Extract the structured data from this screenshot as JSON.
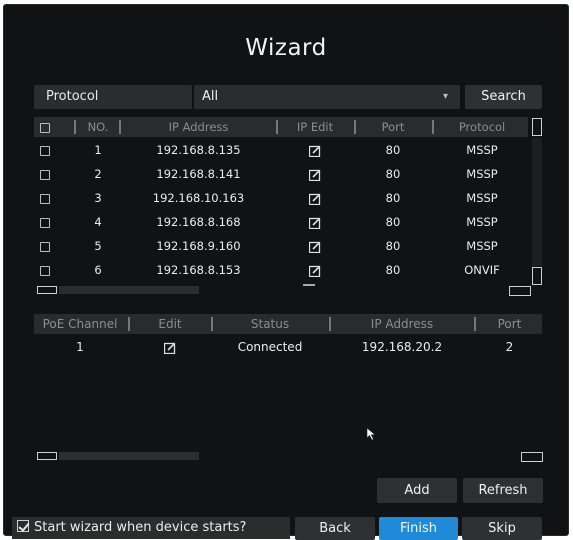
{
  "window": {
    "title": "Wizard"
  },
  "filter": {
    "label": "Protocol",
    "selected": "All",
    "search_label": "Search"
  },
  "device_table": {
    "headers": {
      "no": "NO.",
      "ip": "IP Address",
      "ip_edit": "IP Edit",
      "port": "Port",
      "protocol": "Protocol"
    },
    "rows": [
      {
        "no": "1",
        "ip": "192.168.8.135",
        "port": "80",
        "protocol": "MSSP"
      },
      {
        "no": "2",
        "ip": "192.168.8.141",
        "port": "80",
        "protocol": "MSSP"
      },
      {
        "no": "3",
        "ip": "192.168.10.163",
        "port": "80",
        "protocol": "MSSP"
      },
      {
        "no": "4",
        "ip": "192.168.8.168",
        "port": "80",
        "protocol": "MSSP"
      },
      {
        "no": "5",
        "ip": "192.168.9.160",
        "port": "80",
        "protocol": "MSSP"
      },
      {
        "no": "6",
        "ip": "192.168.8.153",
        "port": "80",
        "protocol": "ONVIF"
      }
    ]
  },
  "poe_table": {
    "headers": {
      "channel": "PoE Channel",
      "edit": "Edit",
      "status": "Status",
      "ip": "IP Address",
      "port": "Port"
    },
    "rows": [
      {
        "channel": "1",
        "status": "Connected",
        "ip": "192.168.20.2",
        "port": "2"
      }
    ]
  },
  "actions": {
    "add_label": "Add",
    "refresh_label": "Refresh",
    "wizard_checkbox_label": "Start wizard when device starts?",
    "back_label": "Back",
    "finish_label": "Finish",
    "skip_label": "Skip"
  },
  "colors": {
    "background": "#111214",
    "finish_accent": "#1e8ad8"
  },
  "icons": [
    "checkbox-icon",
    "edit-icon",
    "dropdown-caret-icon",
    "mouse-cursor-icon"
  ]
}
